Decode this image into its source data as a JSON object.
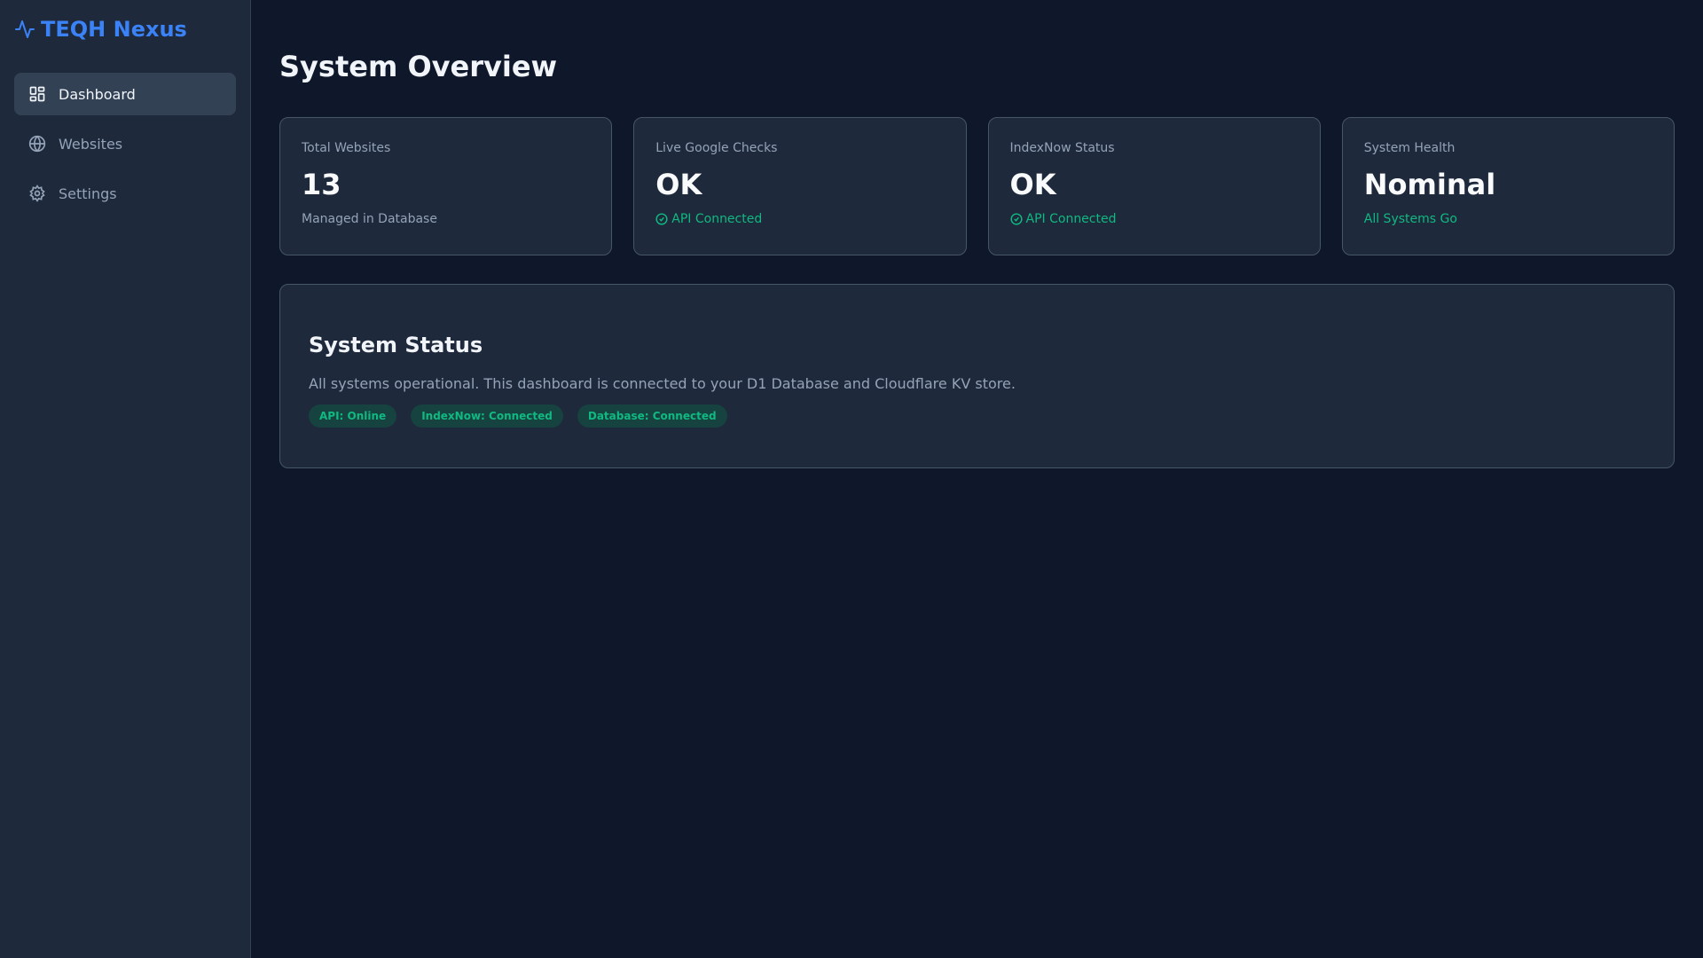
{
  "app": {
    "title": "TEQH Nexus"
  },
  "sidebar": {
    "items": [
      {
        "label": "Dashboard",
        "icon": "dashboard-icon",
        "active": true
      },
      {
        "label": "Websites",
        "icon": "globe-icon"
      },
      {
        "label": "Settings",
        "icon": "gear-icon"
      }
    ]
  },
  "main": {
    "title": "System Overview",
    "cards": [
      {
        "label": "Total Websites",
        "value": "13",
        "sub": "Managed in Database"
      },
      {
        "label": "Live Google Checks",
        "value": "OK",
        "sub": "API Connected"
      },
      {
        "label": "IndexNow Status",
        "value": "OK",
        "sub": "API Connected"
      },
      {
        "label": "System Health",
        "value": "Nominal",
        "sub": "All Systems Go"
      }
    ],
    "status": {
      "title": "System Status",
      "text": "All systems operational. This dashboard is connected to your D1 Database and Cloudflare KV store.",
      "badges": [
        "API: Online",
        "IndexNow: Connected",
        "Database: Connected"
      ]
    }
  },
  "colors": {
    "accent": "#3b82f6",
    "success": "#10b981",
    "bg": "#0f172a",
    "panel": "#1e293b"
  }
}
